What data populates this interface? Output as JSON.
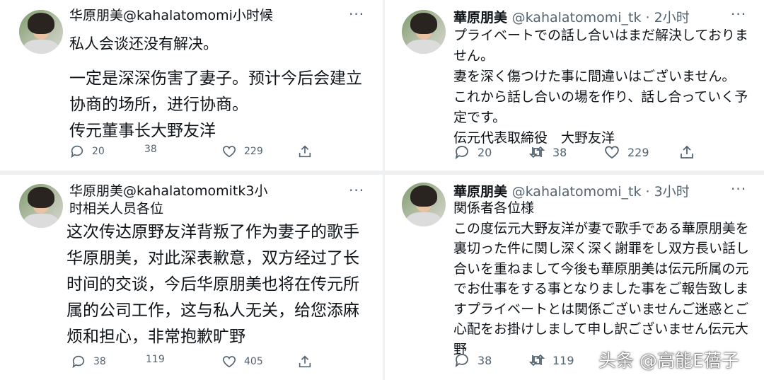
{
  "tl": {
    "header": "华原朋美@kahalatomomi小时候",
    "body_line1": "私人会谈还没有解决。",
    "body_main": "一定是深深伤害了妻子。预计今后会建立\n协商的场所，进行协商。\n传元董事长大野友洋",
    "replies": "20",
    "retweets": "38",
    "likes": "229"
  },
  "tr": {
    "name": "華原朋美",
    "handle": "@kahalatomomi_tk · 2小时",
    "body": "プライベートでの話し合いはまだ解決しておりま\nせん。\n妻を深く傷つけた事に間違いはございません。\nこれから話し合いの場を作り、話し合っていく予\n定です。\n伝元代表取締役　大野友洋",
    "replies": "20",
    "retweets": "38",
    "likes": "229"
  },
  "bl": {
    "header": "华原朋美@kahalatomomitk3小\n时相关人员各位",
    "body": "这次传达原野友洋背叛了作为妻子的歌手\n华原朋美，对此深表歉意，双方经过了长\n时间的交谈，今后华原朋美也将在传元所\n属的公司工作，这与私人无关，给您添麻\n烦和担心，非常抱歉旷野",
    "replies": "38",
    "retweets": "119",
    "likes": "405"
  },
  "br": {
    "name": "華原朋美",
    "handle": "@kahalatomomi_tk · 3小时",
    "body": "関係者各位様\nこの度伝元大野友洋が妻で歌手である華原朋美を\n裏切った件に関し深く深く謝罪をし双方長い話し\n合いを重ねまして今後も華原朋美は伝元所属の元\nでお仕事をする事となりました事をご報告致しま\nすプライベートとは関係ございませんご迷惑とご\n心配をお掛けしまして申し訳ございません伝元大\n野",
    "replies": "38",
    "retweets": "119"
  },
  "more_glyph": "···",
  "watermark": "头条 @高能E蓓子"
}
